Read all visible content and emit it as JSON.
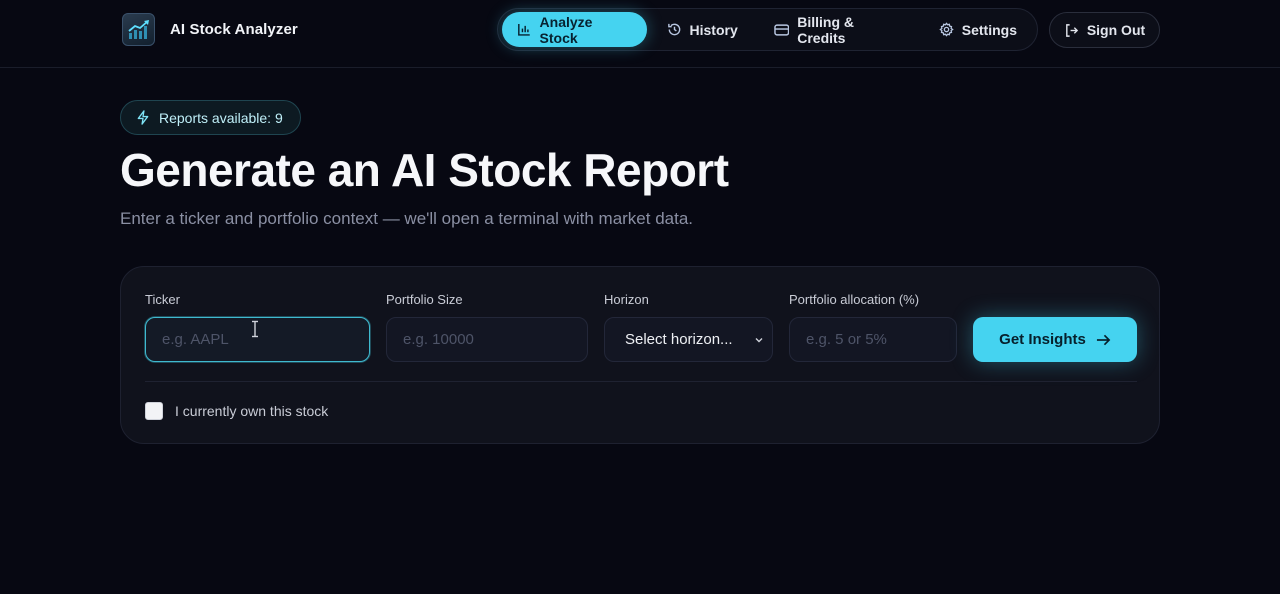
{
  "header": {
    "brand": "AI Stock Analyzer",
    "logo_icon": "chart-trend-up-icon",
    "nav": [
      {
        "label": "Analyze Stock",
        "icon": "bar-chart-icon",
        "active": true
      },
      {
        "label": "History",
        "icon": "history-icon",
        "active": false
      },
      {
        "label": "Billing & Credits",
        "icon": "credit-card-icon",
        "active": false
      },
      {
        "label": "Settings",
        "icon": "gear-icon",
        "active": false
      }
    ],
    "sign_out": "Sign Out"
  },
  "hero": {
    "badge": "Reports available: 9",
    "title": "Generate an AI Stock Report",
    "subtitle": "Enter a ticker and portfolio context — we'll open a terminal with market data."
  },
  "form": {
    "ticker_label": "Ticker",
    "ticker_placeholder": "e.g. AAPL",
    "ticker_value": "",
    "portfolio_size_label": "Portfolio Size",
    "portfolio_size_placeholder": "e.g. 10000",
    "horizon_label": "Horizon",
    "horizon_selected": "Select horizon...",
    "allocation_label": "Portfolio allocation (%)",
    "allocation_placeholder": "e.g. 5 or 5%",
    "submit_label": "Get Insights",
    "own_stock_label": "I currently own this stock",
    "own_stock_checked": false
  },
  "colors": {
    "accent": "#45d3f0",
    "background": "#070812",
    "card": "#10121c"
  }
}
